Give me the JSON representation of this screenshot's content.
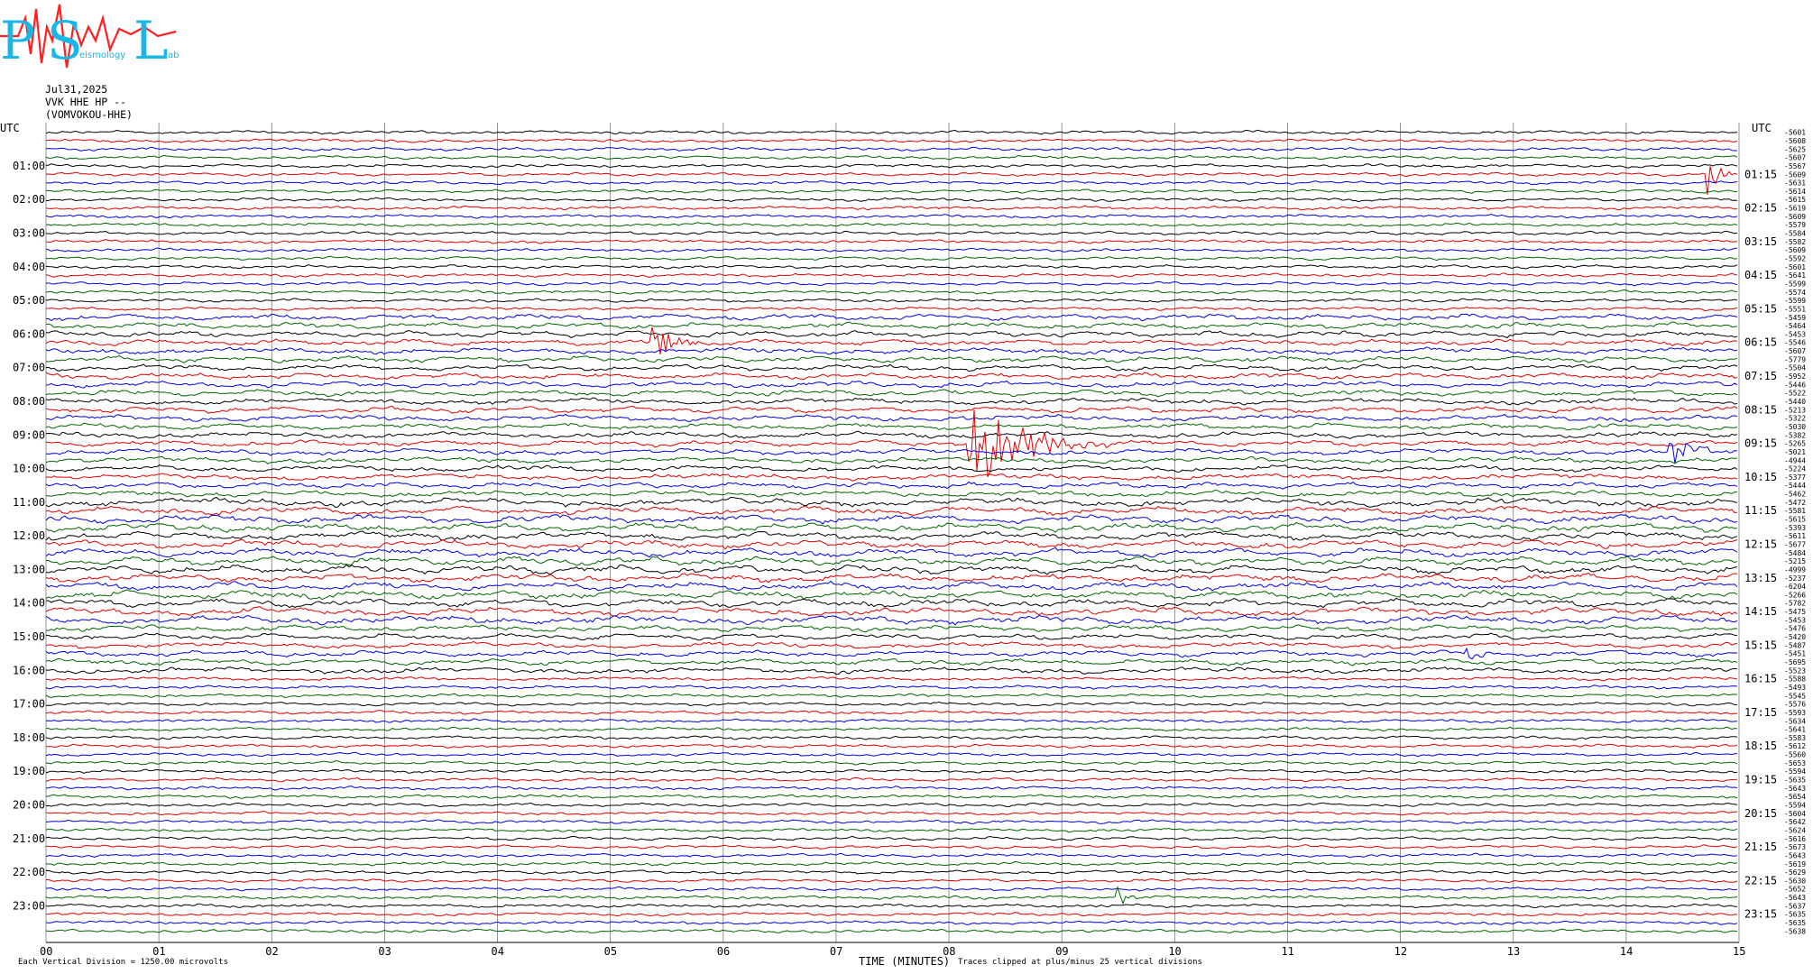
{
  "logo": {
    "letters": [
      "P",
      "S",
      "L"
    ],
    "word_seismology": "eismology",
    "word_lab": "ab"
  },
  "header": {
    "date": "Jul31,2025",
    "station": "VVK HHE HP --",
    "station_name": "(VOMVOKOU-HHE)"
  },
  "chart_data": {
    "type": "line",
    "subtype": "helicorder",
    "xlabel": "TIME (MINUTES)",
    "x_ticks": [
      "00",
      "01",
      "02",
      "03",
      "04",
      "05",
      "06",
      "07",
      "08",
      "09",
      "10",
      "11",
      "12",
      "13",
      "14",
      "15"
    ],
    "x_range": [
      0,
      15
    ],
    "left_axis_title": "UTC",
    "right_axis_title": "UTC",
    "left_hours": [
      "01:00",
      "02:00",
      "03:00",
      "04:00",
      "05:00",
      "06:00",
      "07:00",
      "08:00",
      "09:00",
      "10:00",
      "11:00",
      "12:00",
      "13:00",
      "14:00",
      "15:00",
      "16:00",
      "17:00",
      "18:00",
      "19:00",
      "20:00",
      "21:00",
      "22:00",
      "23:00"
    ],
    "right_hours": [
      "01:15",
      "02:15",
      "03:15",
      "04:15",
      "05:15",
      "06:15",
      "07:15",
      "08:15",
      "09:15",
      "10:15",
      "11:15",
      "12:15",
      "13:15",
      "14:15",
      "15:15",
      "16:15",
      "17:15",
      "18:15",
      "19:15",
      "20:15",
      "21:15",
      "22:15",
      "23:15"
    ],
    "trace_colors": [
      "#000000",
      "#e00000",
      "#0000e0",
      "#006400"
    ],
    "line_count": 96,
    "line_minutes": 15,
    "trace_offsets": [
      "-5601",
      "-5608",
      "-5625",
      "-5607",
      "-5567",
      "-5609",
      "-5631",
      "-5614",
      "-5615",
      "-5619",
      "-5609",
      "-5579",
      "-5584",
      "-5582",
      "-5609",
      "-5592",
      "-5601",
      "-5641",
      "-5599",
      "-5574",
      "-5599",
      "-5551",
      "-5459",
      "-5464",
      "-5453",
      "-5546",
      "-5607",
      "-5779",
      "-5504",
      "-5952",
      "-5446",
      "-5522",
      "-5440",
      "-5213",
      "-5322",
      "-5030",
      "-5382",
      "-5265",
      "-5021",
      "-4944",
      "-5224",
      "-5377",
      "-5444",
      "-5462",
      "-5472",
      "-5581",
      "-5615",
      "-5393",
      "-5611",
      "-5677",
      "-5484",
      "-5215",
      "-4999",
      "-5237",
      "-6204",
      "-5266",
      "-5782",
      "-5475",
      "-5453",
      "-5476",
      "-5420",
      "-5487",
      "-5451",
      "-5695",
      "-5523",
      "-5588",
      "-5493",
      "-5545",
      "-5576",
      "-5593",
      "-5634",
      "-5641",
      "-5583",
      "-5612",
      "-5560",
      "-5653",
      "-5594",
      "-5635",
      "-5643",
      "-5654",
      "-5594",
      "-5604",
      "-5642",
      "-5624",
      "-5616",
      "-5673",
      "-5643",
      "-5619",
      "-5629",
      "-5630",
      "-5652",
      "-5643",
      "-5637",
      "-5635",
      "-5635",
      "-5638"
    ],
    "events": [
      {
        "line": 5,
        "minute": 14.75,
        "amplitude": 2.4,
        "duration": 0.3
      },
      {
        "line": 25,
        "minute": 5.4,
        "amplitude": 2.0,
        "duration": 0.5
      },
      {
        "line": 37,
        "minute": 8.2,
        "amplitude": 6.0,
        "duration": 1.2
      },
      {
        "line": 38,
        "minute": 14.4,
        "amplitude": 2.0,
        "duration": 0.5
      },
      {
        "line": 62,
        "minute": 12.6,
        "amplitude": 1.5,
        "duration": 0.2
      },
      {
        "line": 91,
        "minute": 9.5,
        "amplitude": 1.5,
        "duration": 0.2
      }
    ],
    "notes": {
      "scale": "Each Vertical Division = 1250.00 microvolts",
      "clip": "Traces clipped at plus/minus 25 vertical divisions"
    }
  }
}
